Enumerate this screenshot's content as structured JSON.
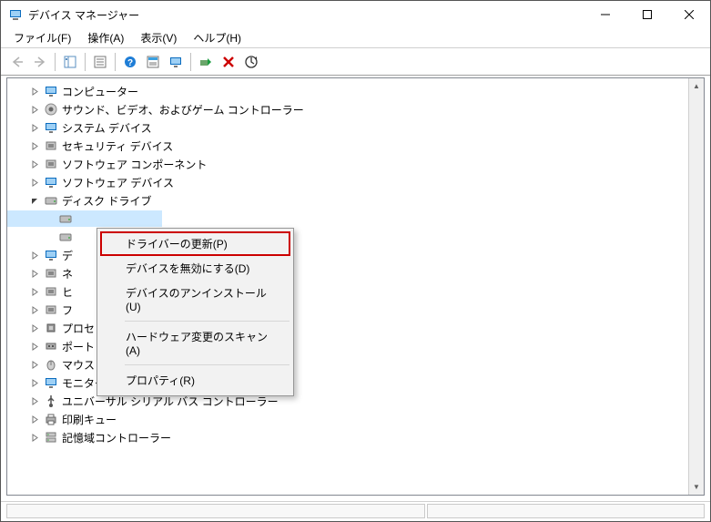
{
  "window": {
    "title": "デバイス マネージャー"
  },
  "menu": {
    "file": "ファイル(F)",
    "action": "操作(A)",
    "view": "表示(V)",
    "help": "ヘルプ(H)"
  },
  "tree": {
    "items": [
      {
        "label": "コンピューター",
        "expanded": false,
        "level": 1,
        "icon": "monitor"
      },
      {
        "label": "サウンド、ビデオ、およびゲーム コントローラー",
        "expanded": false,
        "level": 1,
        "icon": "speaker"
      },
      {
        "label": "システム デバイス",
        "expanded": false,
        "level": 1,
        "icon": "monitor"
      },
      {
        "label": "セキュリティ デバイス",
        "expanded": false,
        "level": 1,
        "icon": "device"
      },
      {
        "label": "ソフトウェア コンポーネント",
        "expanded": false,
        "level": 1,
        "icon": "device"
      },
      {
        "label": "ソフトウェア デバイス",
        "expanded": false,
        "level": 1,
        "icon": "monitor"
      },
      {
        "label": "ディスク ドライブ",
        "expanded": true,
        "level": 1,
        "icon": "disk"
      },
      {
        "label": "",
        "expanded": null,
        "level": 2,
        "icon": "disk",
        "selected": true
      },
      {
        "label": "",
        "expanded": null,
        "level": 2,
        "icon": "disk"
      },
      {
        "label": "デ",
        "expanded": false,
        "level": 1,
        "icon": "monitor",
        "cut": true
      },
      {
        "label": "ネ",
        "expanded": false,
        "level": 1,
        "icon": "device",
        "cut": true
      },
      {
        "label": "ヒ",
        "expanded": false,
        "level": 1,
        "icon": "device",
        "cut": true
      },
      {
        "label": "フ",
        "expanded": false,
        "level": 1,
        "icon": "device",
        "cut": true
      },
      {
        "label": "プロセッサ",
        "expanded": false,
        "level": 1,
        "icon": "cpu"
      },
      {
        "label": "ポート (COM と LPT)",
        "expanded": false,
        "level": 1,
        "icon": "port"
      },
      {
        "label": "マウスとそのほかのポインティング デバイス",
        "expanded": false,
        "level": 1,
        "icon": "mouse"
      },
      {
        "label": "モニター",
        "expanded": false,
        "level": 1,
        "icon": "monitor"
      },
      {
        "label": "ユニバーサル シリアル バス コントローラー",
        "expanded": false,
        "level": 1,
        "icon": "usb"
      },
      {
        "label": "印刷キュー",
        "expanded": false,
        "level": 1,
        "icon": "printer"
      },
      {
        "label": "記憶域コントローラー",
        "expanded": false,
        "level": 1,
        "icon": "storage"
      }
    ]
  },
  "context_menu": {
    "update_driver": "ドライバーの更新(P)",
    "disable": "デバイスを無効にする(D)",
    "uninstall": "デバイスのアンインストール(U)",
    "scan": "ハードウェア変更のスキャン(A)",
    "properties": "プロパティ(R)"
  },
  "toolbar_icons": {
    "back": "back-arrow",
    "forward": "forward-arrow",
    "show_hide": "show-hide-tree",
    "properties": "properties",
    "help": "help",
    "update_driver": "update-driver",
    "monitor": "monitor-refresh",
    "enable": "enable-device",
    "uninstall": "uninstall-device",
    "scan": "scan-hardware"
  }
}
